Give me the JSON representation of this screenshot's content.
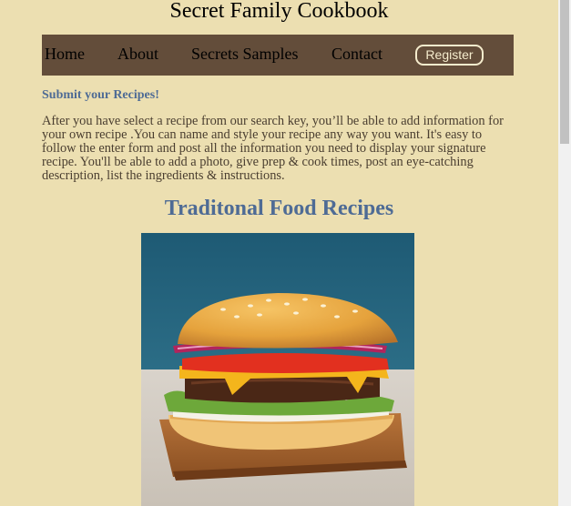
{
  "header": {
    "title": "Secret Family Cookbook"
  },
  "nav": {
    "items": [
      {
        "label": "Home"
      },
      {
        "label": "About"
      },
      {
        "label": "Secrets Samples"
      },
      {
        "label": "Contact"
      }
    ],
    "register_label": "Register"
  },
  "main": {
    "submit_heading": "Submit your Recipes!",
    "intro": "After you have select a recipe from our search key, you’ll be able to add information for your own recipe .You can name and style your recipe any way you want. It's easy to follow the enter form and post all the information you need to display your signature recipe. You'll be able to add a photo, give prep & cook times, post an eye-catching description, list the ingredients & instructions.",
    "section_title": "Traditonal Food Recipes"
  },
  "colors": {
    "page_bg": "#ecdfb1",
    "nav_bg": "#634d3a",
    "heading_blue": "#4e6b95",
    "register_border": "#f5eccd"
  }
}
